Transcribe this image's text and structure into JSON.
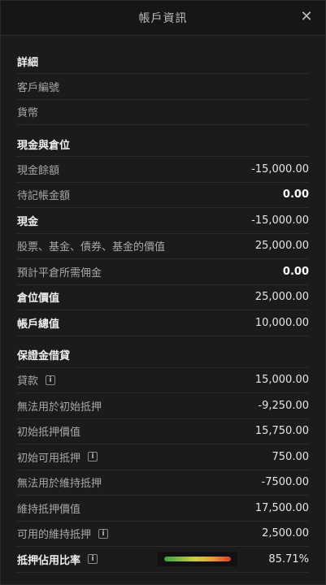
{
  "header": {
    "title": "帳戶資訊",
    "close_icon": "close-icon"
  },
  "details": {
    "title": "詳細",
    "rows": [
      {
        "label": "客戶編號",
        "value": ""
      },
      {
        "label": "貨幣",
        "value": ""
      }
    ]
  },
  "cash": {
    "title": "現金與倉位",
    "rows": [
      {
        "label": "現金餘額",
        "value": "-15,000.00",
        "bold": false,
        "value_bold": false
      },
      {
        "label": "待記帳金額",
        "value": "0.00",
        "bold": false,
        "value_bold": true
      },
      {
        "label": "現金",
        "value": "-15,000.00",
        "bold": true,
        "value_bold": false
      },
      {
        "label": "股票、基金、債券、基金的價值",
        "value": "25,000.00",
        "bold": false,
        "value_bold": false
      },
      {
        "label": "預計平倉所需佣金",
        "value": "0.00",
        "bold": false,
        "value_bold": true
      },
      {
        "label": "倉位價值",
        "value": "25,000.00",
        "bold": true,
        "value_bold": false
      },
      {
        "label": "帳戶總值",
        "value": "10,000.00",
        "bold": true,
        "value_bold": false
      }
    ]
  },
  "margin": {
    "title": "保證金借貸",
    "rows": [
      {
        "label": "貸款",
        "value": "15,000.00",
        "info": true
      },
      {
        "label": "無法用於初始抵押",
        "value": "-9,250.00",
        "info": false
      },
      {
        "label": "初始抵押價值",
        "value": "15,750.00",
        "info": false
      },
      {
        "label": "初始可用抵押",
        "value": "750.00",
        "info": true
      },
      {
        "label": "無法用於維持抵押",
        "value": "-7500.00",
        "info": false
      },
      {
        "label": "維持抵押價值",
        "value": "17,500.00",
        "info": false
      },
      {
        "label": "可用的維持抵押",
        "value": "2,500.00",
        "info": true
      }
    ],
    "utilization": {
      "label": "抵押佔用比率",
      "value": "85.71%",
      "level": 0.8571
    }
  },
  "colors": {
    "background": "#1b1b1b",
    "divider": "#2b2b2b",
    "gauge": [
      "#3aa24a",
      "#c8d13a",
      "#e9a23a",
      "#d8402c"
    ]
  }
}
